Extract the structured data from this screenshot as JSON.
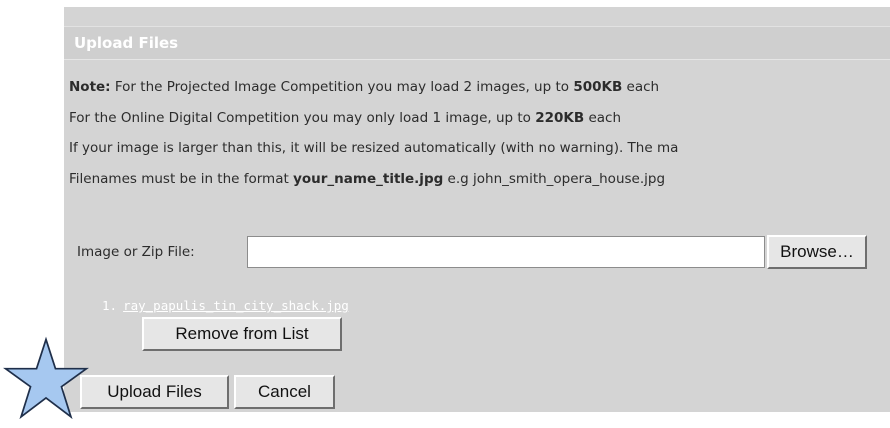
{
  "panel": {
    "title": "Upload Files"
  },
  "notes": {
    "line1": {
      "prefix": "Note:",
      "text": " For the Projected Image Competition you may load 2 images, up to ",
      "bold": "500KB",
      "suffix": " each"
    },
    "line2": {
      "text": "For the Online Digital Competition you may only load 1 image, up to ",
      "bold": "220KB",
      "suffix": " each"
    },
    "line3": {
      "text": "If your image is larger than this, it will be resized automatically (with no warning). The ma"
    },
    "line4": {
      "text": "Filenames must be in the format ",
      "bold": "your_name_title.jpg",
      "suffix": " e.g john_smith_opera_house.jpg"
    }
  },
  "file_picker": {
    "label": "Image or Zip File:",
    "value": "",
    "browse_label": "Browse…"
  },
  "file_list": {
    "items": [
      {
        "number": "1.",
        "name": "ray_papulis_tin_city_shack.jpg"
      }
    ],
    "remove_label": "Remove from List"
  },
  "actions": {
    "upload_label": "Upload Files",
    "cancel_label": "Cancel"
  },
  "colors": {
    "panel_bg": "#d4d4d4",
    "title_text": "#ffffff",
    "star_fill": "#a6c8f0",
    "star_stroke": "#1f2f4a"
  },
  "icons": {
    "star": "star-icon"
  }
}
